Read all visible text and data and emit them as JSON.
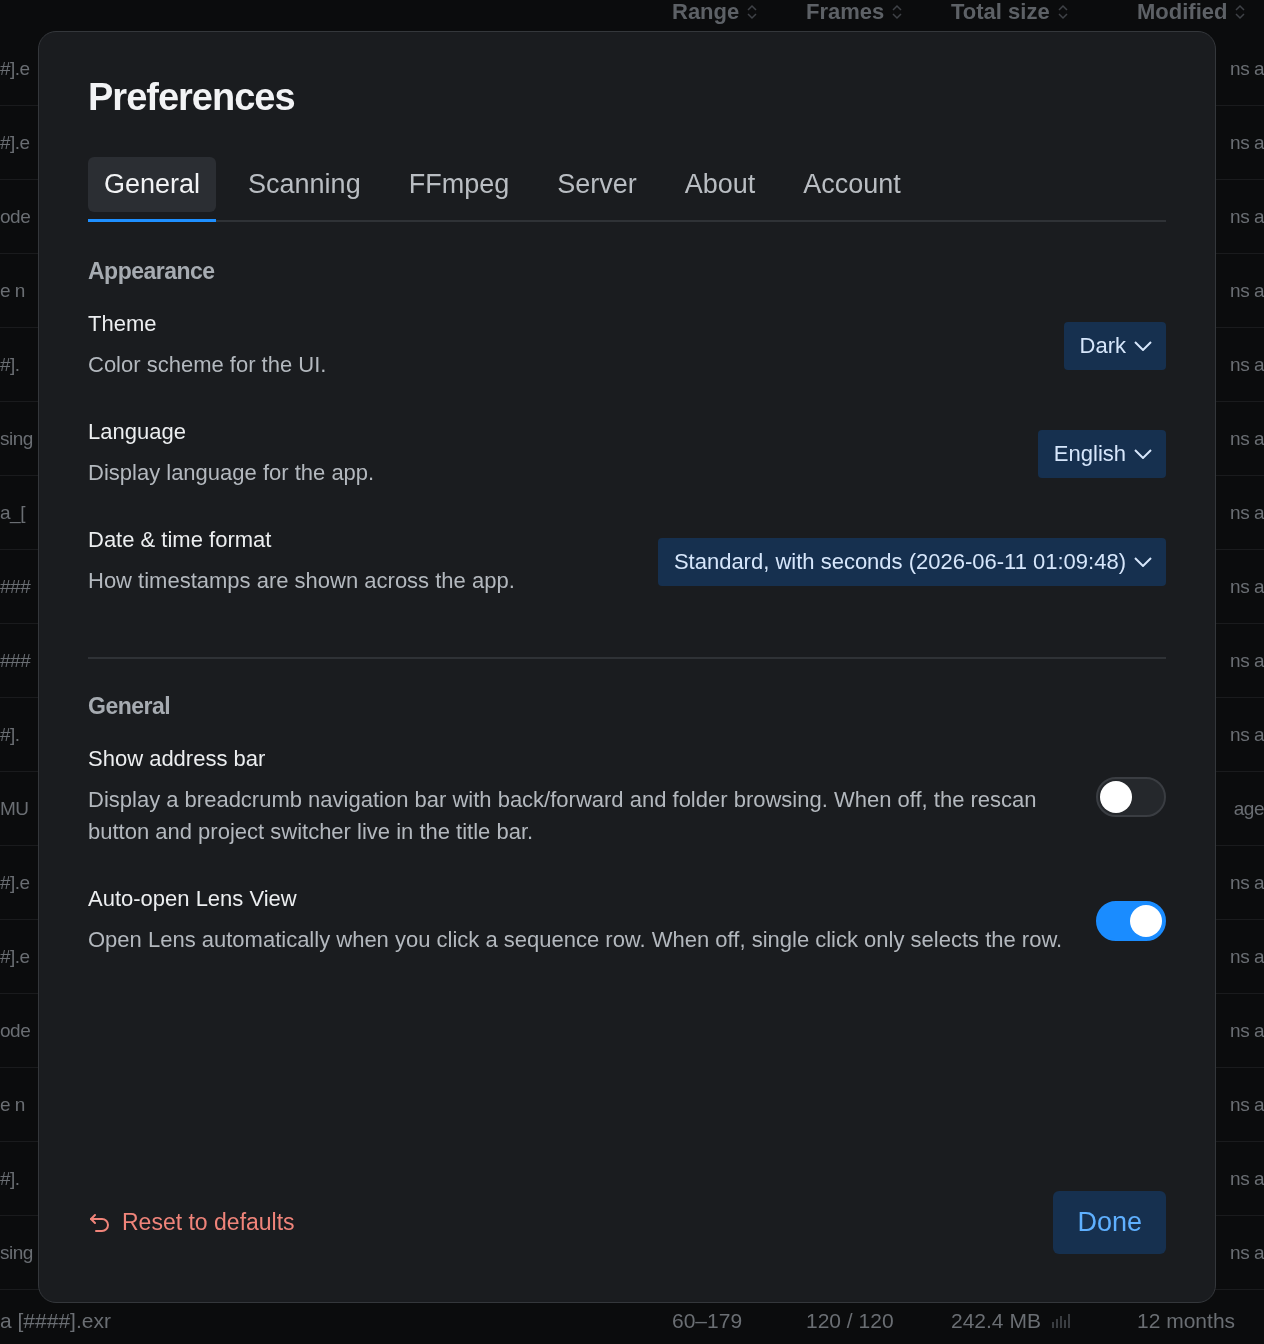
{
  "background_table": {
    "columns": [
      {
        "label": "Range"
      },
      {
        "label": "Frames"
      },
      {
        "label": "Total size"
      },
      {
        "label": "Modified"
      }
    ],
    "rows": [
      {
        "column_1": "#].e",
        "column_2": "ns a"
      },
      {
        "column_1": "#].e",
        "column_2": "ns a"
      },
      {
        "column_1": "ode",
        "column_2": "ns a"
      },
      {
        "column_1": "e n",
        "column_2": "ns a"
      },
      {
        "column_1": "#].",
        "column_2": "ns a"
      },
      {
        "column_1": "sing",
        "column_2": "ns a"
      },
      {
        "column_1": "a_[",
        "column_2": "ns a"
      },
      {
        "column_1": "###",
        "column_2": "ns a"
      },
      {
        "column_1": "###",
        "column_2": "ns a"
      },
      {
        "column_1": "#].",
        "column_2": "ns a"
      },
      {
        "column_1": "MU",
        "column_2": "age"
      },
      {
        "column_1": "#].e",
        "column_2": "ns a"
      },
      {
        "column_1": "#].e",
        "column_2": "ns a"
      },
      {
        "column_1": "ode",
        "column_2": "ns a"
      },
      {
        "column_1": "e n",
        "column_2": "ns a"
      },
      {
        "column_1": "#].",
        "column_2": "ns a"
      },
      {
        "column_1": "sing",
        "column_2": "ns a"
      }
    ],
    "last_row": {
      "name": "a [####].exr",
      "range": "60–179",
      "frames": "120 / 120",
      "total_size": "242.4 MB",
      "modified": "12 months"
    }
  },
  "dialog": {
    "title": "Preferences",
    "tabs": [
      {
        "label": "General",
        "selected": true
      },
      {
        "label": "Scanning",
        "selected": false
      },
      {
        "label": "FFmpeg",
        "selected": false
      },
      {
        "label": "Server",
        "selected": false
      },
      {
        "label": "About",
        "selected": false
      },
      {
        "label": "Account",
        "selected": false
      }
    ],
    "sections": [
      {
        "heading": "Appearance",
        "settings": [
          {
            "kind": "select",
            "label": "Theme",
            "description": "Color scheme for the UI.",
            "value": "Dark"
          },
          {
            "kind": "select",
            "label": "Language",
            "description": "Display language for the app.",
            "value": "English"
          },
          {
            "kind": "select",
            "label": "Date & time format",
            "description": "How timestamps are shown across the app.",
            "value": "Standard, with seconds (2026-06-11 01:09:48)"
          }
        ]
      },
      {
        "heading": "General",
        "settings": [
          {
            "kind": "toggle",
            "label": "Show address bar",
            "description": "Display a breadcrumb navigation bar with back/forward and folder browsing. When off, the rescan button and project switcher live in the title bar.",
            "on": false
          },
          {
            "kind": "toggle",
            "label": "Auto-open Lens View",
            "description": "Open Lens automatically when you click a sequence row. When off, single click only selects the row.",
            "on": true
          }
        ]
      }
    ],
    "footer": {
      "reset_label": "Reset to defaults",
      "done_label": "Done"
    }
  }
}
